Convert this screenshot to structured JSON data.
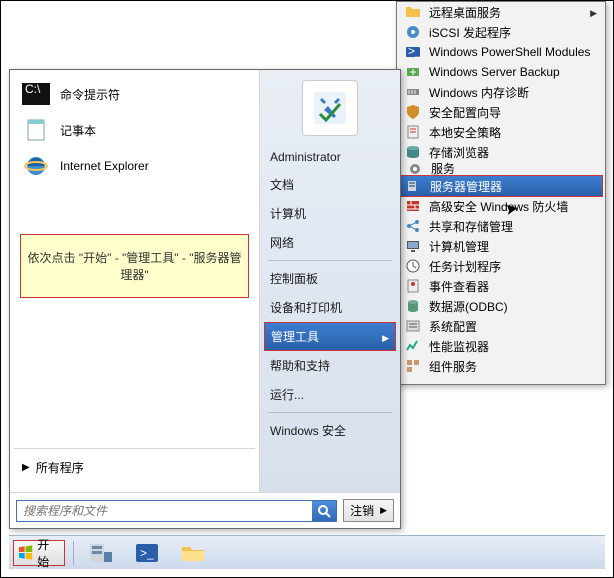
{
  "start_menu": {
    "pinned": [
      {
        "label": "命令提示符"
      },
      {
        "label": "记事本"
      },
      {
        "label": "Internet Explorer"
      }
    ],
    "callout": "依次点击 \"开始\" - \"管理工具\" - \"服务器管理器\"",
    "all_programs": "所有程序",
    "search_placeholder": "搜索程序和文件",
    "logoff": "注销",
    "right": {
      "user": "Administrator",
      "items_top": [
        "文档",
        "计算机",
        "网络"
      ],
      "items_mid": [
        "控制面板",
        "设备和打印机"
      ],
      "admin_tools": "管理工具",
      "items_bot": [
        "帮助和支持",
        "运行..."
      ],
      "security": "Windows 安全"
    }
  },
  "submenu": {
    "items": [
      "远程桌面服务",
      "iSCSI 发起程序",
      "Windows PowerShell Modules",
      "Windows Server Backup",
      "Windows 内存诊断",
      "安全配置向导",
      "本地安全策略",
      "存储浏览器",
      "服务",
      "服务器管理器",
      "高级安全 Windows 防火墙",
      "共享和存储管理",
      "计算机管理",
      "任务计划程序",
      "事件查看器",
      "数据源(ODBC)",
      "系统配置",
      "性能监视器",
      "组件服务"
    ],
    "highlight_index": 9
  },
  "taskbar": {
    "start": "开始"
  }
}
